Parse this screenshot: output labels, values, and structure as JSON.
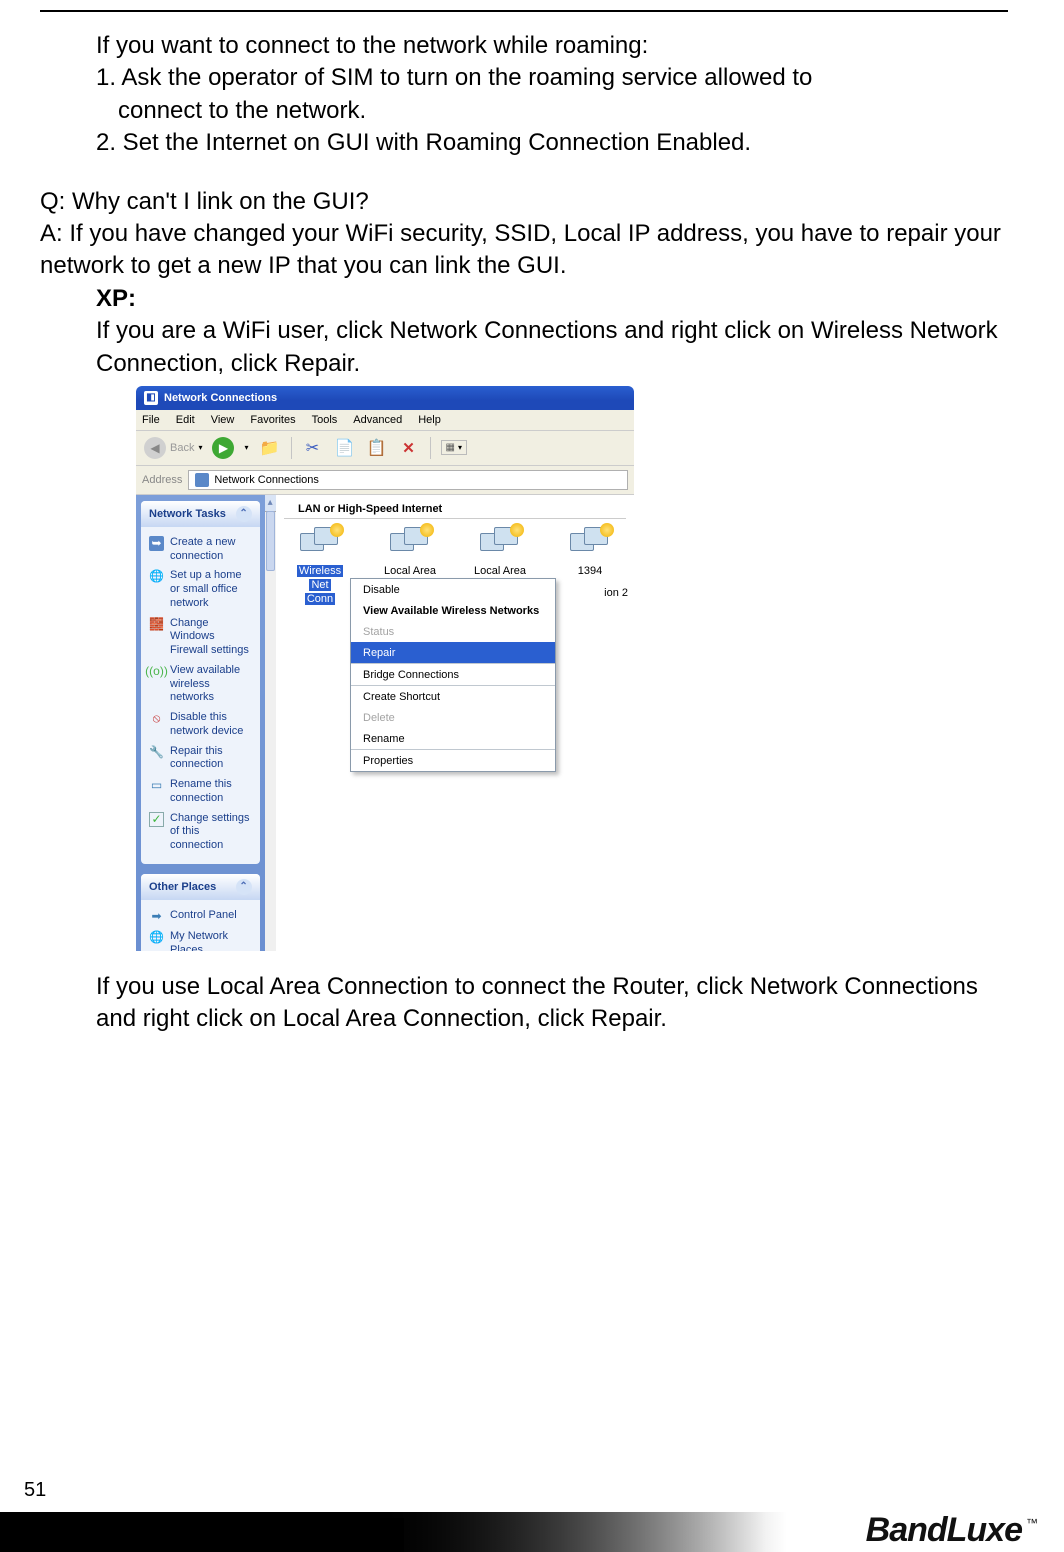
{
  "doc": {
    "p1": "If you want to connect to the network while roaming:",
    "li1": "1. Ask the operator of SIM to turn on the roaming service allowed to connect to the network.",
    "li1b": "connect to the network.",
    "li1a": "1. Ask the operator of SIM to turn on the roaming service allowed to",
    "li2": "2. Set the Internet on GUI with Roaming Connection Enabled.",
    "q": "Q: Why can't I link on the GUI?",
    "a": "A:    If you have changed your WiFi security, SSID, Local IP address, you have to repair your network to get a new IP that you can link the GUI.",
    "xp": "XP:",
    "xp_p": "If you are a WiFi user, click Network Connections and right click on Wireless Network Connection, click Repair.",
    "p2": "If you use Local Area Connection to connect the Router, click Network Connections and right click on Local Area Connection, click Repair."
  },
  "shot": {
    "title": "Network Connections",
    "menu": [
      "File",
      "Edit",
      "View",
      "Favorites",
      "Tools",
      "Advanced",
      "Help"
    ],
    "toolbar": {
      "back": "Back"
    },
    "address_label": "Address",
    "address_value": "Network Connections",
    "sidebar": {
      "group1": {
        "title": "Network Tasks",
        "items": [
          "Create a new connection",
          "Set up a home or small office network",
          "Change Windows Firewall settings",
          "View available wireless networks",
          "Disable this network device",
          "Repair this connection",
          "Rename this connection",
          "Change settings of this connection"
        ]
      },
      "group2": {
        "title": "Other Places",
        "items": [
          "Control Panel",
          "My Network Places"
        ]
      }
    },
    "main": {
      "group_title": "LAN or High-Speed Internet",
      "icons": [
        "Wireless",
        "Local Area",
        "Local Area",
        "1394"
      ],
      "sel_a": "Net",
      "sel_b": "Conn",
      "trail": "ion 2"
    },
    "context_menu": {
      "items": [
        {
          "label": "Disable",
          "type": "normal"
        },
        {
          "label": "View Available Wireless Networks",
          "type": "bold"
        },
        {
          "label": "Status",
          "type": "disabled"
        },
        {
          "label": "Repair",
          "type": "highlight"
        },
        {
          "label": "Bridge Connections",
          "type": "normal",
          "sep_before": true
        },
        {
          "label": "Create Shortcut",
          "type": "normal",
          "sep_before": true
        },
        {
          "label": "Delete",
          "type": "disabled"
        },
        {
          "label": "Rename",
          "type": "normal"
        },
        {
          "label": "Properties",
          "type": "normal",
          "sep_before": true
        }
      ]
    }
  },
  "footer": {
    "page": "51",
    "brand": "BandLuxe",
    "tm": "™"
  }
}
